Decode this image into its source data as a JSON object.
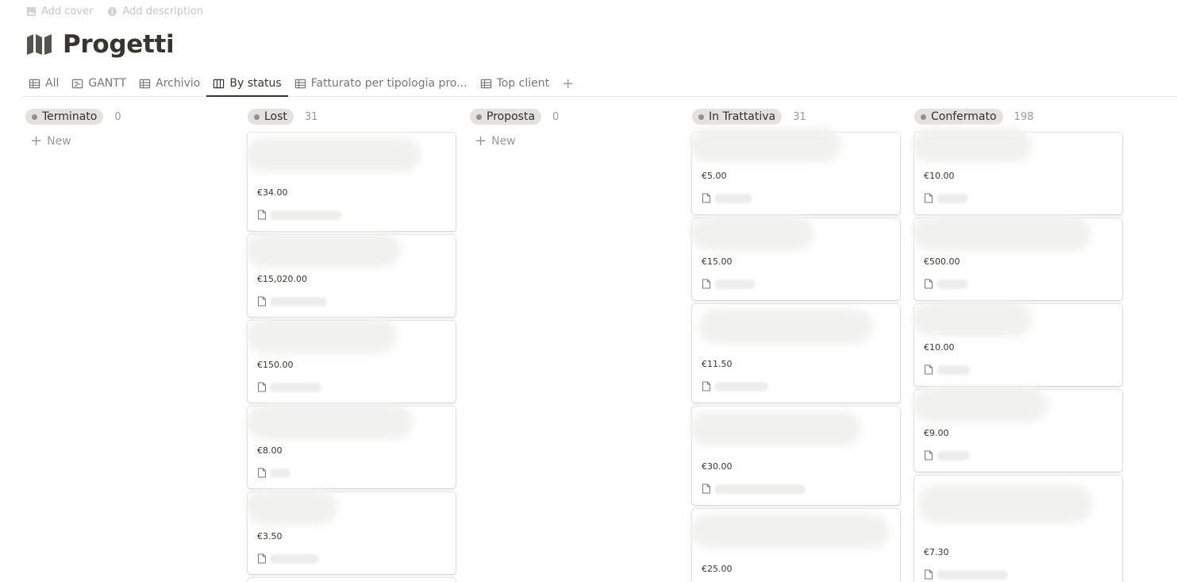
{
  "top_actions": {
    "add_cover": "Add cover",
    "add_description": "Add description"
  },
  "page": {
    "title": "Progetti",
    "icon": "map-icon"
  },
  "tabs": [
    {
      "label": "All",
      "icon": "table-icon",
      "active": false
    },
    {
      "label": "GANTT",
      "icon": "timeline-icon",
      "active": false
    },
    {
      "label": "Archivio",
      "icon": "table-icon",
      "active": false
    },
    {
      "label": "By status",
      "icon": "board-icon",
      "active": true
    },
    {
      "label": "Fatturato per tipologia pro...",
      "icon": "table-icon",
      "active": false
    },
    {
      "label": "Top client",
      "icon": "table-icon",
      "active": false
    }
  ],
  "board": {
    "new_label": "New",
    "columns": [
      {
        "name": "Terminato",
        "count": "0",
        "color": "#e3e2e0",
        "cards": []
      },
      {
        "name": "Lost",
        "count": "31",
        "color": "#e3e2e0",
        "cards": [
          {
            "price": "€34.00"
          },
          {
            "price": "€15,020.00"
          },
          {
            "price": "€150.00"
          },
          {
            "price": "€8.00"
          },
          {
            "price": "€3.50"
          }
        ]
      },
      {
        "name": "Proposta",
        "count": "0",
        "color": "#e3e2e0",
        "cards": []
      },
      {
        "name": "In Trattativa",
        "count": "31",
        "color": "#e3e2e0",
        "cards": [
          {
            "price": "€5.00"
          },
          {
            "price": "€15.00"
          },
          {
            "price": "€11.50"
          },
          {
            "price": "€30.00"
          },
          {
            "price": "€25.00"
          }
        ]
      },
      {
        "name": "Confermato",
        "count": "198",
        "color": "#e3e2e0",
        "cards": [
          {
            "price": "€10.00"
          },
          {
            "price": "€500.00"
          },
          {
            "price": "€10.00"
          },
          {
            "price": "€9.00"
          },
          {
            "price": "€7.30"
          }
        ]
      }
    ]
  }
}
